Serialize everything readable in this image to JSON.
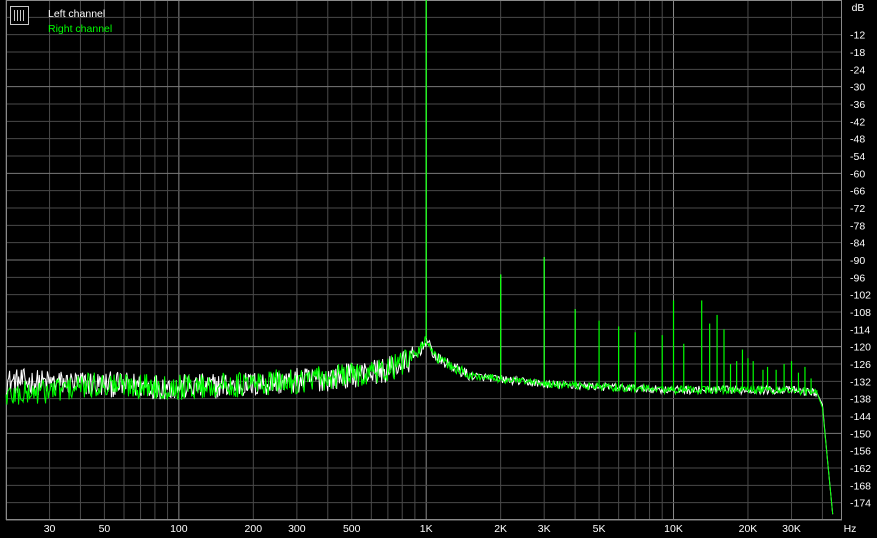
{
  "chart_data": {
    "type": "line",
    "title": "",
    "xlabel": "Hz",
    "ylabel": "dB",
    "x_scale": "log",
    "xlim": [
      20,
      48000
    ],
    "ylim": [
      -180,
      0
    ],
    "grid": true,
    "legend_position": "top-left",
    "x_tick_labels": [
      {
        "value": 30,
        "label": "30"
      },
      {
        "value": 50,
        "label": "50"
      },
      {
        "value": 100,
        "label": "100"
      },
      {
        "value": 200,
        "label": "200"
      },
      {
        "value": 300,
        "label": "300"
      },
      {
        "value": 500,
        "label": "500"
      },
      {
        "value": 1000,
        "label": "1K"
      },
      {
        "value": 2000,
        "label": "2K"
      },
      {
        "value": 3000,
        "label": "3K"
      },
      {
        "value": 5000,
        "label": "5K"
      },
      {
        "value": 10000,
        "label": "10K"
      },
      {
        "value": 20000,
        "label": "20K"
      },
      {
        "value": 30000,
        "label": "30K"
      }
    ],
    "y_tick_values": [
      -12,
      -18,
      -24,
      -30,
      -36,
      -42,
      -48,
      -54,
      -60,
      -66,
      -72,
      -78,
      -84,
      -90,
      -96,
      -102,
      -108,
      -114,
      -120,
      -126,
      -132,
      -138,
      -144,
      -150,
      -156,
      -162,
      -168,
      -174
    ],
    "series": [
      {
        "name": "Left channel",
        "color": "#ffffff",
        "noise_floor": [
          [
            20,
            -132
          ],
          [
            50,
            -133
          ],
          [
            100,
            -134
          ],
          [
            200,
            -133
          ],
          [
            400,
            -131
          ],
          [
            700,
            -128
          ],
          [
            900,
            -124
          ],
          [
            1000,
            -118
          ],
          [
            1100,
            -124
          ],
          [
            1500,
            -130
          ],
          [
            3000,
            -133
          ],
          [
            10000,
            -135
          ],
          [
            30000,
            -135
          ],
          [
            38000,
            -136
          ]
        ],
        "peaks": [
          [
            1000,
            0
          ],
          [
            2000,
            -95
          ],
          [
            3000,
            -89
          ],
          [
            4000,
            -107
          ]
        ],
        "rolloff": [
          [
            38000,
            -136
          ],
          [
            40000,
            -140
          ],
          [
            42000,
            -160
          ],
          [
            44000,
            -178
          ]
        ]
      },
      {
        "name": "Right channel",
        "color": "#00ff00",
        "noise_floor": [
          [
            20,
            -137
          ],
          [
            50,
            -133
          ],
          [
            100,
            -134
          ],
          [
            200,
            -133
          ],
          [
            400,
            -131
          ],
          [
            700,
            -128
          ],
          [
            900,
            -124
          ],
          [
            1000,
            -117
          ],
          [
            1100,
            -124
          ],
          [
            1500,
            -130
          ],
          [
            3000,
            -133
          ],
          [
            10000,
            -135
          ],
          [
            30000,
            -135
          ],
          [
            38000,
            -136
          ]
        ],
        "peaks": [
          [
            1000,
            0
          ],
          [
            2000,
            -95
          ],
          [
            3000,
            -89
          ],
          [
            4000,
            -107
          ],
          [
            5000,
            -111
          ],
          [
            6000,
            -113
          ],
          [
            7000,
            -115
          ],
          [
            9000,
            -116
          ],
          [
            10000,
            -104
          ],
          [
            11000,
            -119
          ],
          [
            13000,
            -104
          ],
          [
            14000,
            -112
          ],
          [
            15000,
            -109
          ],
          [
            16000,
            -114
          ],
          [
            17000,
            -126
          ],
          [
            18000,
            -125
          ],
          [
            19000,
            -121
          ],
          [
            20000,
            -124
          ],
          [
            21000,
            -125
          ],
          [
            23000,
            -128
          ],
          [
            24000,
            -127
          ],
          [
            26000,
            -128
          ],
          [
            28000,
            -126
          ],
          [
            30000,
            -125
          ],
          [
            32000,
            -129
          ],
          [
            34000,
            -127
          ],
          [
            36000,
            -131
          ]
        ],
        "rolloff": [
          [
            38000,
            -136
          ],
          [
            40000,
            -141
          ],
          [
            42000,
            -160
          ],
          [
            44000,
            -178
          ]
        ]
      }
    ]
  }
}
